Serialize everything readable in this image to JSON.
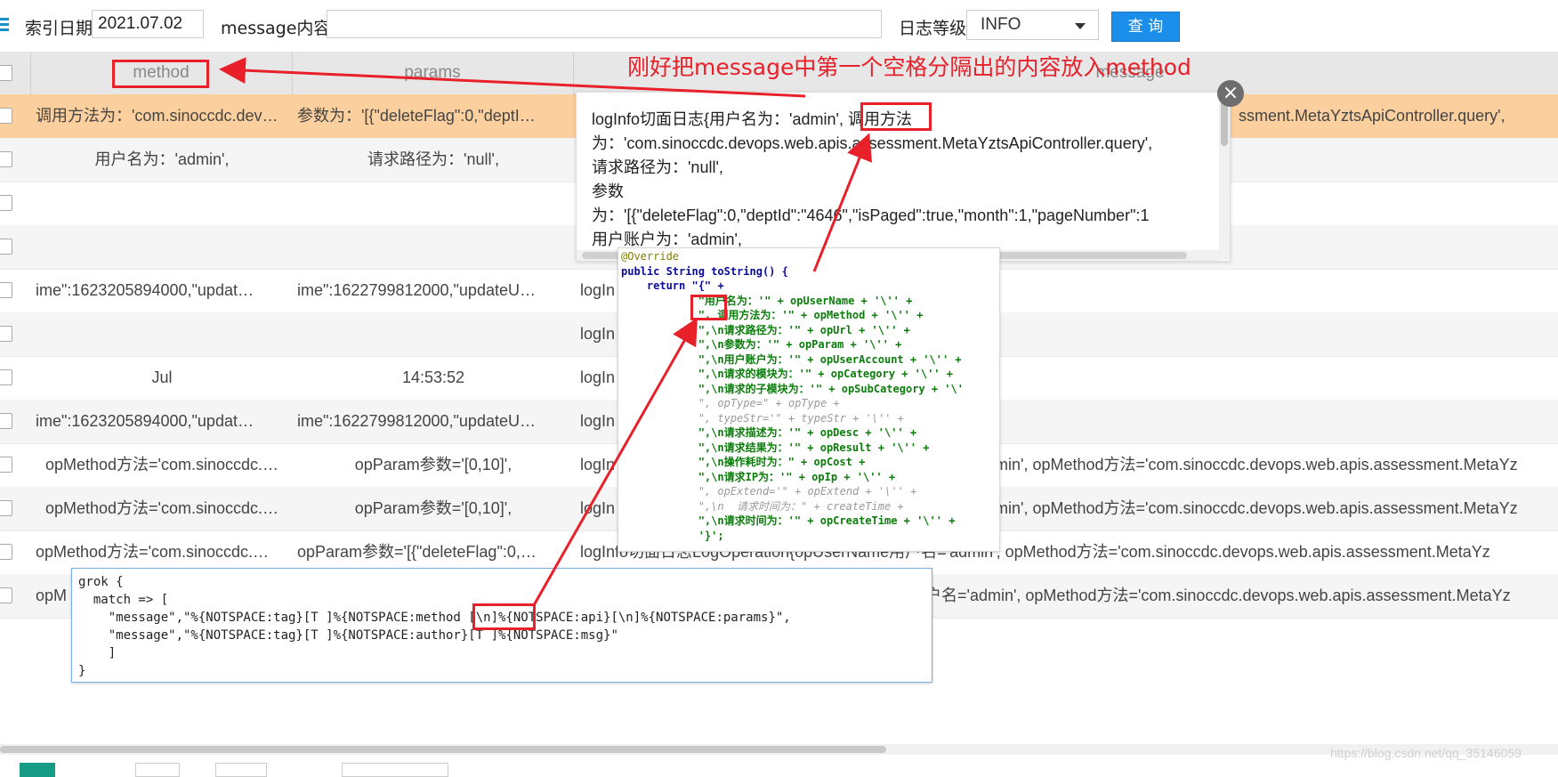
{
  "filters": {
    "index_date_label": "索引日期",
    "index_date_value": "2021.07.02",
    "message_label": "message内容",
    "message_value": "",
    "level_label": "日志等级",
    "level_value": "INFO",
    "query_label": "查 询"
  },
  "table": {
    "headers": {
      "method": "method",
      "params": "params",
      "message": "message"
    },
    "rows": [
      {
        "method": "调用方法为：'com.sinoccdc.dev…",
        "params": "参数为：'[{\"deleteFlag\":0,\"deptI…",
        "message": "ssment.MetaYztsApiController.query',"
      },
      {
        "method": "用户名为：'admin',",
        "params": "请求路径为：'null',",
        "message": ""
      },
      {
        "method": "",
        "params": "",
        "message": ""
      },
      {
        "method": "",
        "params": "",
        "message": ""
      },
      {
        "method": "ime\":1623205894000,\"updat…",
        "params": "ime\":1622799812000,\"updateU…",
        "message": "logIn"
      },
      {
        "method": "",
        "params": "",
        "message": "logIn"
      },
      {
        "method": "Jul",
        "params": "14:53:52",
        "message": "logIn"
      },
      {
        "method": "ime\":1623205894000,\"updat…",
        "params": "ime\":1622799812000,\"updateU…",
        "message": "logIn"
      },
      {
        "method": "opMethod方法='com.sinoccdc.…",
        "params": "opParam参数='[0,10]',",
        "message": "logIn",
        "message_tail": "min', opMethod方法='com.sinoccdc.devops.web.apis.assessment.MetaYz"
      },
      {
        "method": "opMethod方法='com.sinoccdc.…",
        "params": "opParam参数='[0,10]',",
        "message": "logIn",
        "message_tail": "min', opMethod方法='com.sinoccdc.devops.web.apis.assessment.MetaYz"
      },
      {
        "method": "opMethod方法='com.sinoccdc.…",
        "params": "opParam参数='[{\"deleteFlag\":0,…",
        "message": "logInfo切面日志LogOperation{opUserName用户名='admin', opMethod方法='com.sinoccdc.devops.web.apis.assessment.MetaYz"
      },
      {
        "method": "opM",
        "params": "",
        "message": "",
        "message_tail": "户名='admin', opMethod方法='com.sinoccdc.devops.web.apis.assessment.MetaYz"
      }
    ]
  },
  "popup": {
    "lines": [
      "logInfo切面日志{用户名为：'admin', 调用方法",
      "为：'com.sinoccdc.devops.web.apis.assessment.MetaYztsApiController.query',",
      "请求路径为：'null',",
      "参数",
      "为：'[{\"deleteFlag\":0,\"deptId\":\"4646\",\"isPaged\":true,\"month\":1,\"pageNumber\":1",
      "用户账户为：'admin',"
    ],
    "close_symbol": "×"
  },
  "annotation": "刚好把message中第一个空格分隔出的内容放入method",
  "code_tostring": [
    "@Override",
    "public String toString() {",
    "    return \"{\" +",
    "            \"用户名为：'\" + opUserName + '\\'' +",
    "            \", 调用方法为：'\" + opMethod + '\\'' +",
    "            \",\\n请求路径为：'\" + opUrl + '\\'' +",
    "            \",\\n参数为：'\" + opParam + '\\'' +",
    "            \",\\n用户账户为：'\" + opUserAccount + '\\'' +",
    "            \",\\n请求的模块为：'\" + opCategory + '\\'' +",
    "            \",\\n请求的子模块为：'\" + opSubCategory + '\\'",
    "            \", opType=\" + opType +",
    "            \", typeStr='\" + typeStr + '\\'' +",
    "            \",\\n请求描述为：'\" + opDesc + '\\'' +",
    "            \",\\n请求结果为：'\" + opResult + '\\'' +",
    "            \",\\n操作耗时为：\" + opCost +",
    "            \",\\n请求IP为：'\" + opIp + '\\'' +",
    "            \", opExtend='\" + opExtend + '\\'' +",
    "            \",\\n  请求时间为：\" + createTime +",
    "            \",\\n请求时间为：'\" + opCreateTime + '\\'' +",
    "            '}';"
  ],
  "code_grok": [
    "grok {",
    "  match => [",
    "    \"message\",\"%{NOTSPACE:tag}[T ]%{NOTSPACE:method [\\n]%{NOTSPACE:api}[\\n]%{NOTSPACE:params}\",",
    "    \"message\",\"%{NOTSPACE:tag}[T ]%{NOTSPACE:author}[T ]%{NOTSPACE:msg}\"",
    "    ]",
    "}"
  ],
  "watermark": "https://blog.csdn.net/qq_35146059",
  "colors": {
    "accent": "#1a8ee8",
    "selected_row": "#fbd09e",
    "annotation": "#e8202a",
    "pager_active": "#169c86"
  }
}
